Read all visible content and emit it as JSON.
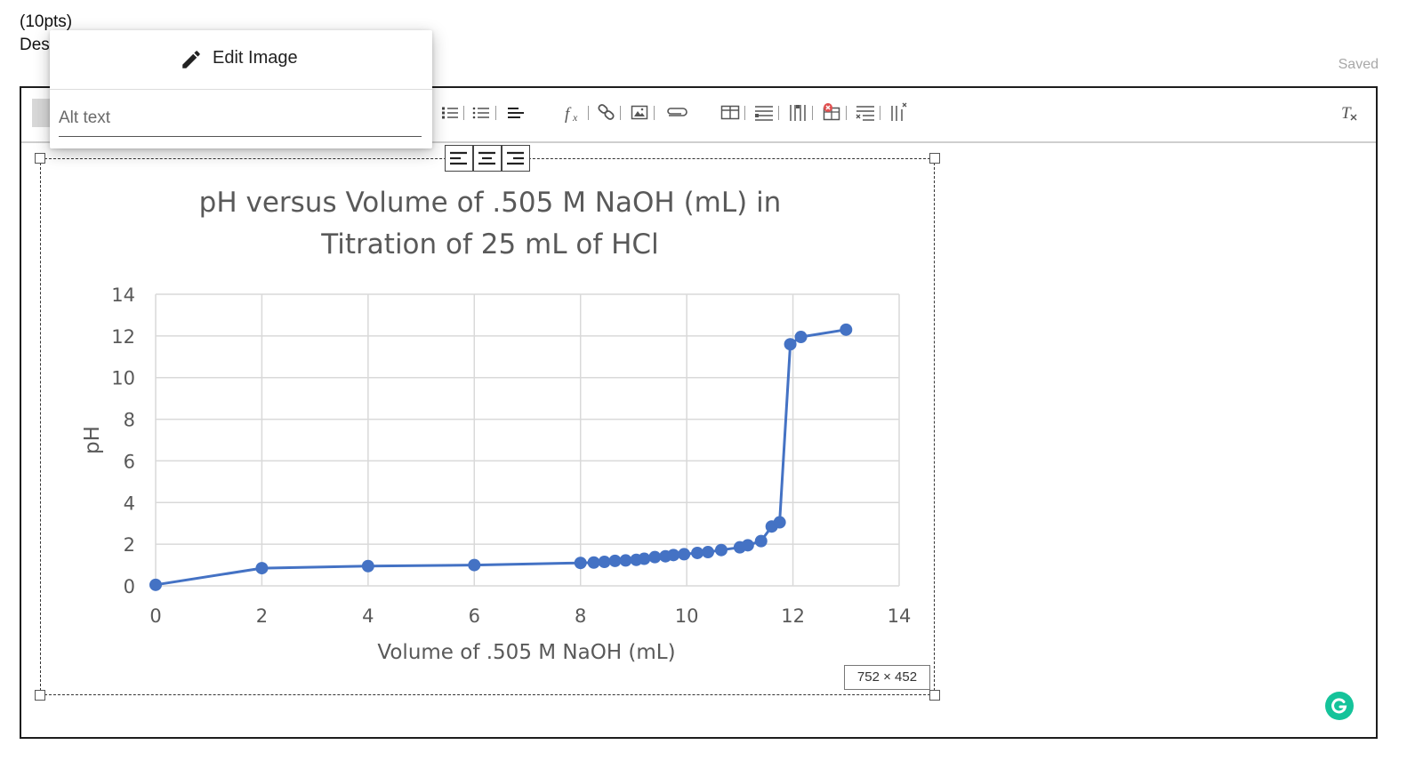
{
  "question": {
    "points": "(10pts)",
    "desc": "Des"
  },
  "status": {
    "saved": "Saved"
  },
  "popup": {
    "edit_label": "Edit Image",
    "alt_placeholder": "Alt text"
  },
  "image": {
    "size_label": "752 × 452"
  },
  "chart_data": {
    "type": "line",
    "title_line1": "pH versus Volume of .505 M NaOH (mL) in",
    "title_line2": "Titration of 25 mL of HCl",
    "xlabel": "Volume of .505 M NaOH (mL)",
    "ylabel": "pH",
    "xlim": [
      0,
      14
    ],
    "ylim": [
      0,
      14
    ],
    "xticks": [
      "0",
      "2",
      "4",
      "6",
      "8",
      "10",
      "12",
      "14"
    ],
    "yticks": [
      "0",
      "2",
      "4",
      "6",
      "8",
      "10",
      "12",
      "14"
    ],
    "grid": true,
    "legend": "none",
    "series_color": "#4472c4",
    "x": [
      0,
      2,
      4,
      6,
      8,
      8.25,
      8.45,
      8.65,
      8.85,
      9.05,
      9.2,
      9.4,
      9.6,
      9.75,
      9.95,
      10.2,
      10.4,
      10.65,
      11.0,
      11.15,
      11.4,
      11.6,
      11.75,
      11.95,
      12.15,
      13.0
    ],
    "y": [
      0.05,
      0.85,
      0.95,
      1.0,
      1.1,
      1.12,
      1.15,
      1.2,
      1.22,
      1.25,
      1.3,
      1.38,
      1.42,
      1.48,
      1.52,
      1.58,
      1.62,
      1.72,
      1.85,
      1.95,
      2.15,
      2.85,
      3.05,
      11.6,
      11.95,
      12.3
    ]
  }
}
